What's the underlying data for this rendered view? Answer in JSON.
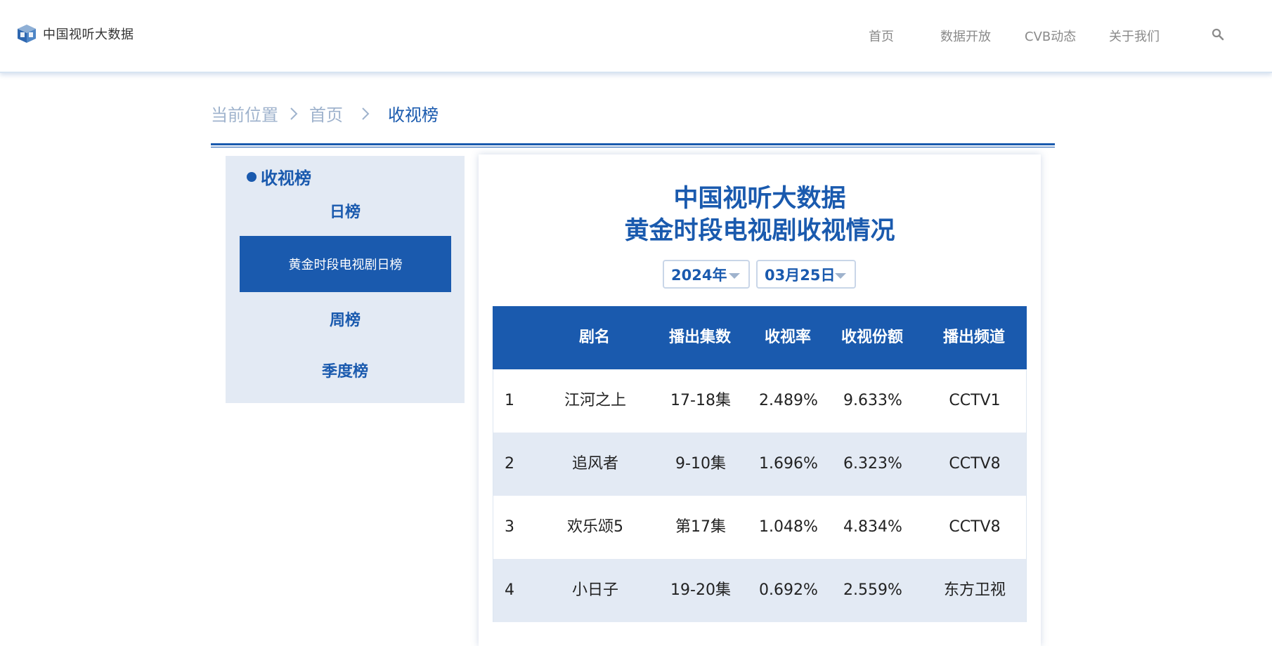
{
  "brand": {
    "logo_icon": "tv-cube-logo-icon",
    "name": "中国视听大数据"
  },
  "nav": {
    "items": [
      "首页",
      "数据开放",
      "CVB动态",
      "关于我们"
    ],
    "search_icon": "search-icon"
  },
  "breadcrumb": {
    "prefix": "当前位置",
    "sep": ">",
    "home": "首页",
    "current": "收视榜"
  },
  "sidebar": {
    "title": "收视榜",
    "daily": "日榜",
    "active": "黄金时段电视剧日榜",
    "weekly": "周榜",
    "quarterly": "季度榜"
  },
  "panel": {
    "title_line1": "中国视听大数据",
    "title_line2": "黄金时段电视剧收视情况",
    "year_select": "2024年",
    "date_select": "03月25日"
  },
  "table": {
    "headers": [
      "",
      "剧名",
      "播出集数",
      "收视率",
      "收视份额",
      "播出频道"
    ],
    "rows": [
      [
        "1",
        "江河之上",
        "17-18集",
        "2.489%",
        "9.633%",
        "CCTV1"
      ],
      [
        "2",
        "追风者",
        "9-10集",
        "1.696%",
        "6.323%",
        "CCTV8"
      ],
      [
        "3",
        "欢乐颂5",
        "第17集",
        "1.048%",
        "4.834%",
        "CCTV8"
      ],
      [
        "4",
        "小日子",
        "19-20集",
        "0.692%",
        "2.559%",
        "东方卫视"
      ]
    ]
  },
  "colors": {
    "accent": "#1a5aae",
    "sidebar_bg": "#e3eaf4",
    "nav_text": "#8a8a8a",
    "breadcrumb_muted": "#9fb3cd"
  }
}
